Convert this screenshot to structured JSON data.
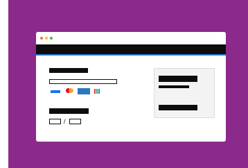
{
  "colors": {
    "background": "#8b2a8b",
    "accent": "#1d7fd6",
    "dot_red": "#ff5f57",
    "dot_yellow": "#febc2e",
    "dot_green": "#28c840",
    "card_blue": "#1a73e8",
    "card_red": "#eb001b",
    "card_orange": "#f79e1b",
    "card_amex": "#2e77bc",
    "card_stripes": [
      "#e53935",
      "#43a047",
      "#1e88e5"
    ]
  },
  "payment_form": {
    "date_separator": "/"
  },
  "icons": {
    "window_controls": [
      "close-dot-icon",
      "minimize-dot-icon",
      "maximize-dot-icon"
    ],
    "cards": [
      "visa-card-icon",
      "mastercard-icon",
      "amex-card-icon",
      "discover-card-icon"
    ]
  }
}
